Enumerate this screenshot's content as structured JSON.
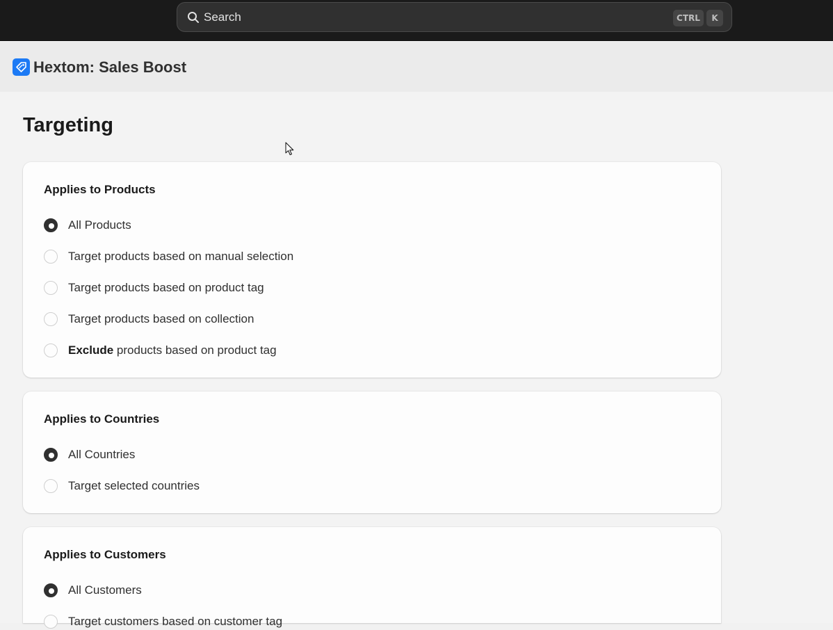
{
  "search": {
    "label": "Search",
    "shortcut_ctrl": "CTRL",
    "shortcut_key": "K"
  },
  "app": {
    "title": "Hextom: Sales Boost",
    "logo_icon": "tag-icon",
    "accent": "#1c7af5"
  },
  "page": {
    "title": "Targeting"
  },
  "products": {
    "heading": "Applies to Products",
    "options": [
      {
        "label": "All Products",
        "checked": true
      },
      {
        "label": "Target products based on manual selection",
        "checked": false
      },
      {
        "label": "Target products based on product tag",
        "checked": false
      },
      {
        "label": "Target products based on collection",
        "checked": false
      },
      {
        "label_strong": "Exclude",
        "label_rest": " products based on product tag",
        "checked": false
      }
    ]
  },
  "countries": {
    "heading": "Applies to Countries",
    "options": [
      {
        "label": "All Countries",
        "checked": true
      },
      {
        "label": "Target selected countries",
        "checked": false
      }
    ]
  },
  "customers": {
    "heading": "Applies to Customers",
    "options": [
      {
        "label": "All Customers",
        "checked": true
      },
      {
        "label": "Target customers based on customer tag",
        "checked": false
      }
    ]
  }
}
